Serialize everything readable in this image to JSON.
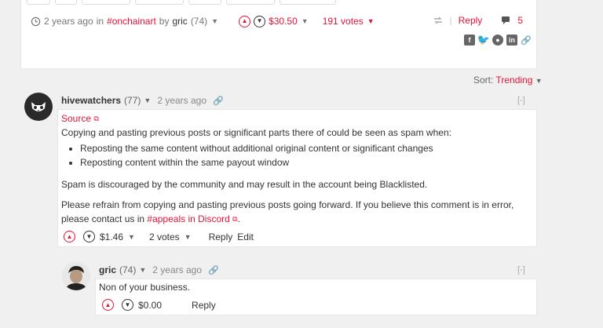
{
  "post": {
    "time": "2 years ago",
    "in_word": "in",
    "tag": "#onchainart",
    "by_word": "by",
    "author": "gric",
    "author_rep": "(74)",
    "payout": "$30.50",
    "votes": "191 votes",
    "reply_label": "Reply",
    "comment_count": "5"
  },
  "sort": {
    "label": "Sort:",
    "value": "Trending"
  },
  "comments": [
    {
      "author": "hivewatchers",
      "rep": "(77)",
      "time": "2 years ago",
      "collapse": "[-]",
      "source_link": "Source",
      "intro": "Copying and pasting previous posts or significant parts there of could be seen as spam when:",
      "bullets": [
        "Reposting the same content without additional original content or significant changes",
        "Reposting content within the same payout window"
      ],
      "para1": "Spam is discouraged by the community and may result in the account being Blacklisted.",
      "para2_a": "Please refrain from copying and pasting previous posts going forward. If you believe this comment is in error, please contact us in ",
      "para2_link": "#appeals in Discord",
      "para2_b": ".",
      "payout": "$1.46",
      "votes": "2 votes",
      "reply_label": "Reply",
      "edit_label": "Edit"
    },
    {
      "author": "gric",
      "rep": "(74)",
      "time": "2 years ago",
      "collapse": "[-]",
      "body": "Non of your business.",
      "payout": "$0.00",
      "reply_label": "Reply"
    }
  ]
}
